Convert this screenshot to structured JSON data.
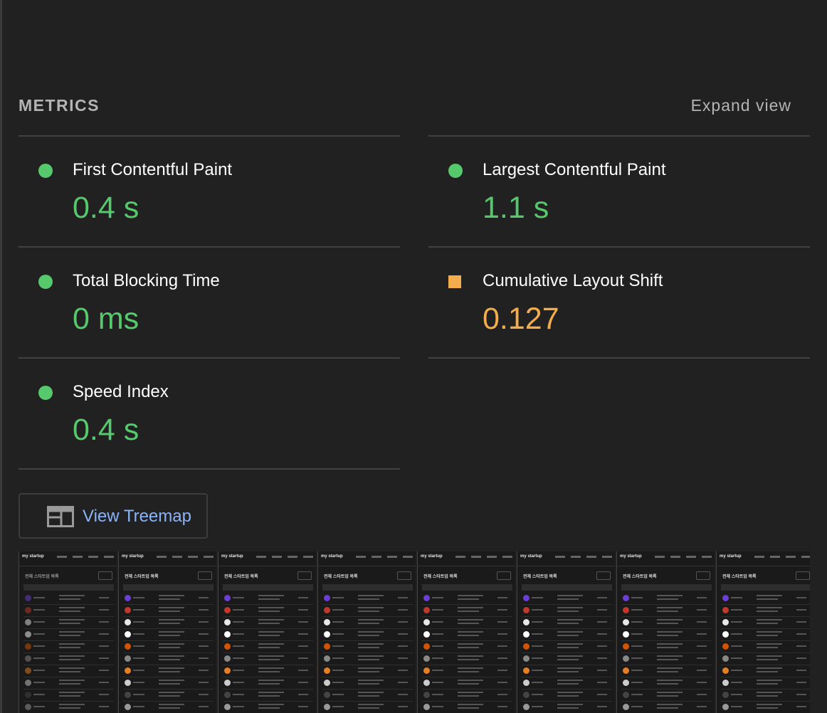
{
  "header": {
    "title": "METRICS",
    "expand_label": "Expand view"
  },
  "metrics": {
    "left": [
      {
        "label": "First Contentful Paint",
        "value": "0.4 s",
        "status": "pass",
        "color": "#55c96b"
      },
      {
        "label": "Total Blocking Time",
        "value": "0 ms",
        "status": "pass",
        "color": "#55c96b"
      },
      {
        "label": "Speed Index",
        "value": "0.4 s",
        "status": "pass",
        "color": "#55c96b"
      }
    ],
    "right": [
      {
        "label": "Largest Contentful Paint",
        "value": "1.1 s",
        "status": "pass",
        "color": "#55c96b"
      },
      {
        "label": "Cumulative Layout Shift",
        "value": "0.127",
        "status": "average",
        "color": "#f4ad4c"
      }
    ]
  },
  "treemap_button": {
    "label": "View Treemap",
    "icon": "treemap-icon",
    "color": "#8ab4f8"
  },
  "filmstrip": {
    "frame_count": 8,
    "frames": [
      {
        "brand_top": "ᵛᵃᵛᵃ",
        "brand": "my startup",
        "heading": "전체 스타트업 목록"
      },
      {
        "brand_top": "ᵛᵃᵛᵃ",
        "brand": "my startup",
        "heading": "전체 스타트업 목록"
      },
      {
        "brand_top": "ᵛᵃᵛᵃ",
        "brand": "my startup",
        "heading": "전체 스타트업 목록"
      },
      {
        "brand_top": "ᵛᵃᵛᵃ",
        "brand": "my startup",
        "heading": "전체 스타트업 목록"
      },
      {
        "brand_top": "ᵛᵃᵛᵃ",
        "brand": "my startup",
        "heading": "전체 스타트업 목록"
      },
      {
        "brand_top": "ᵛᵃᵛᵃ",
        "brand": "my startup",
        "heading": "전체 스타트업 목록"
      },
      {
        "brand_top": "ᵛᵃᵛᵃ",
        "brand": "my startup",
        "heading": "전체 스타트업 목록"
      },
      {
        "brand_top": "ᵛᵃᵛᵃ",
        "brand": "my startup",
        "heading": "전체 스타트업 목록"
      }
    ]
  },
  "colors": {
    "background": "#212121",
    "pass": "#55c96b",
    "average": "#f4ad4c",
    "label": "#ffffff",
    "muted": "#b4b4b4",
    "link": "#8ab4f8"
  }
}
